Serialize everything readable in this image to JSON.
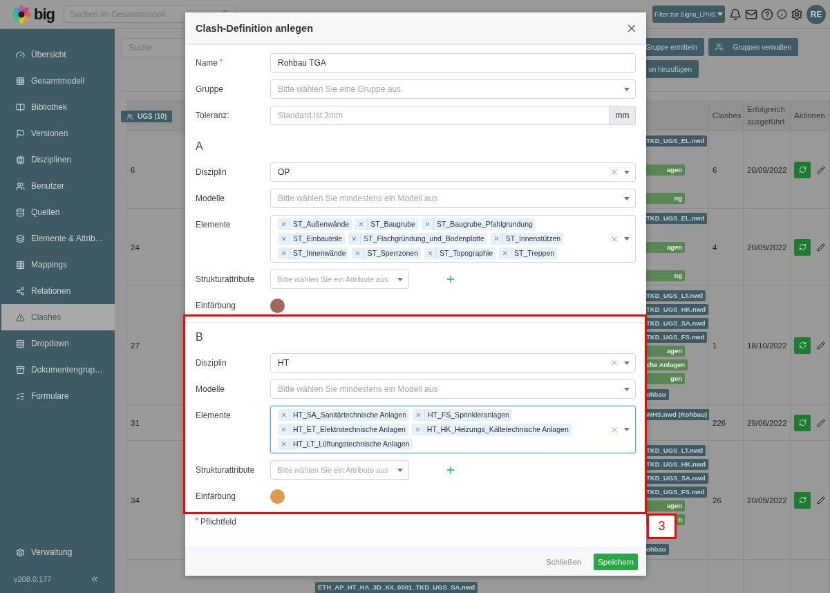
{
  "topbar": {
    "logo": "big",
    "search_placeholder": "Suchen im Gesamtmodell",
    "filter_button": "Filter zur Signa_LPH5",
    "avatar": "RE"
  },
  "sidebar": {
    "items": [
      {
        "label": "Übersicht",
        "selected": false
      },
      {
        "label": "Gesamtmodell",
        "selected": false
      },
      {
        "label": "Bibliothek",
        "selected": false
      },
      {
        "label": "Versionen",
        "selected": false
      },
      {
        "label": "Disziplinen",
        "selected": false
      },
      {
        "label": "Benutzer",
        "selected": false
      },
      {
        "label": "Quellen",
        "selected": false
      },
      {
        "label": "Elemente & Attrib…",
        "selected": false
      },
      {
        "label": "Mappings",
        "selected": false
      },
      {
        "label": "Relationen",
        "selected": false
      },
      {
        "label": "Clashes",
        "selected": true
      },
      {
        "label": "Dropdown",
        "selected": false
      },
      {
        "label": "Dokumentengrup…",
        "selected": false
      },
      {
        "label": "Formulare",
        "selected": false
      }
    ],
    "footer_item": "Verwaltung",
    "version": "v208.0.177"
  },
  "toolbar": {
    "search_placeholder": "Suche",
    "buttons": [
      "Gruppe ermitteln",
      "Gruppen verwalten"
    ],
    "second_row_button": "on hinzufügen"
  },
  "table": {
    "group": "UGS (10)",
    "columns": [
      "Clashes",
      "Erfolgreich ausgeführt",
      "Aktionen"
    ],
    "rows": [
      {
        "id": "6",
        "tags": [
          {
            "text": "TKD_UGS_EL.nwd",
            "kind": "file"
          },
          {
            "text": "agen",
            "kind": "category"
          },
          {
            "text": "ng",
            "kind": "category"
          }
        ],
        "clashes": "6",
        "date": "20/09/2022"
      },
      {
        "id": "24",
        "tags": [
          {
            "text": "TKD_UGS_EL.nwd",
            "kind": "file"
          },
          {
            "text": "agen",
            "kind": "category"
          },
          {
            "text": "ng",
            "kind": "category"
          }
        ],
        "clashes": "4",
        "date": "20/09/2022"
      },
      {
        "id": "27",
        "tags": [
          {
            "text": "TKD_UGS_LT.nwd",
            "kind": "file"
          },
          {
            "text": "TKD_UGS_HK.nwd",
            "kind": "file"
          },
          {
            "text": "TKD_UGS_SA.nwd",
            "kind": "file"
          },
          {
            "text": "TKD_UGS_FS.nwd",
            "kind": "file"
          },
          {
            "text": "agen",
            "kind": "category"
          },
          {
            "text": "che Anlagen",
            "kind": "category"
          },
          {
            "text": "gen",
            "kind": "category"
          },
          {
            "text": "ohbau",
            "kind": "file"
          }
        ],
        "clashes": "1",
        "date": "18/10/2022"
      },
      {
        "id": "31",
        "tags": [
          {
            "text": "WHS.nwd (Rohbau)",
            "kind": "file"
          }
        ],
        "clashes": "226",
        "date": "29/06/2022"
      },
      {
        "id": "34",
        "tags": [
          {
            "text": "TKD_UGS_LT.nwd",
            "kind": "file"
          },
          {
            "text": "TKD_UGS_HK.nwd",
            "kind": "file"
          },
          {
            "text": "TKD_UGS_SA.nwd",
            "kind": "file"
          },
          {
            "text": "TKD_UGS_FS.nwd",
            "kind": "file"
          },
          {
            "text": "agen",
            "kind": "category"
          },
          {
            "text": "n",
            "kind": "category"
          },
          {
            "text": "ohbau",
            "kind": "file"
          }
        ],
        "clashes": "26",
        "date": "20/09/2022"
      },
      {
        "tags": [
          {
            "text": "ETH_AP_HT_HA_3D_XX_0001_TKD_UGS_SA.nwd",
            "kind": "file"
          }
        ]
      }
    ]
  },
  "dialog": {
    "title": "Clash-Definition anlegen",
    "name": {
      "label": "Name",
      "required_mark": "*",
      "value": "Rohbau TGA"
    },
    "group": {
      "label": "Gruppe",
      "placeholder": "Bitte wählen Sie eine Gruppe aus"
    },
    "tolerance": {
      "label": "Toleranz:",
      "placeholder": "Standard ist 3mm",
      "unit": "mm"
    },
    "sides": [
      {
        "heading": "A",
        "discipline": {
          "label": "Disziplin",
          "value": "OP"
        },
        "models": {
          "label": "Modelle",
          "placeholder": "Bitte wählen Sie mindestens ein Modell aus"
        },
        "elements": {
          "label": "Elemente",
          "focused": false,
          "tags": [
            "ST_Außenwände",
            "ST_Baugrube",
            "ST_Baugrube_Pfahlgrundung",
            "ST_Einbauteile",
            "ST_Flachgründung_und_Bodenplatte",
            "ST_Innenstützen",
            "ST_Innenwände",
            "ST_Sperrzonen",
            "ST_Topographie",
            "ST_Treppen"
          ]
        },
        "structure": {
          "label": "Strukturattribute",
          "placeholder": "Bitte wählen Sie ein Attribute aus"
        },
        "coloring": {
          "label": "Einfärbung",
          "color": "#a0675a"
        }
      },
      {
        "heading": "B",
        "discipline": {
          "label": "Disziplin",
          "value": "HT"
        },
        "models": {
          "label": "Modelle",
          "placeholder": "Bitte wählen Sie mindestens ein Modell aus"
        },
        "elements": {
          "label": "Elemente",
          "focused": true,
          "tags": [
            "HT_SA_Sanitärtechnische Anlagen",
            "HT_FS_Sprinkleranlagen",
            "HT_ET_Elektrotechnische Anlagen",
            "HT_HK_Heizungs_Kältetechnische Anlagen",
            "HT_LT_Lüftungstechnische Anlagen"
          ]
        },
        "structure": {
          "label": "Strukturattribute",
          "placeholder": "Bitte wählen Sie ein Attribute aus"
        },
        "coloring": {
          "label": "Einfärbung",
          "color": "#e09a4c"
        }
      }
    ],
    "footnote": {
      "mark": "*",
      "text": "Pflichtfeld"
    },
    "buttons": {
      "close": "Schließen",
      "save": "Speichern"
    }
  },
  "annotation": {
    "label": "3"
  }
}
